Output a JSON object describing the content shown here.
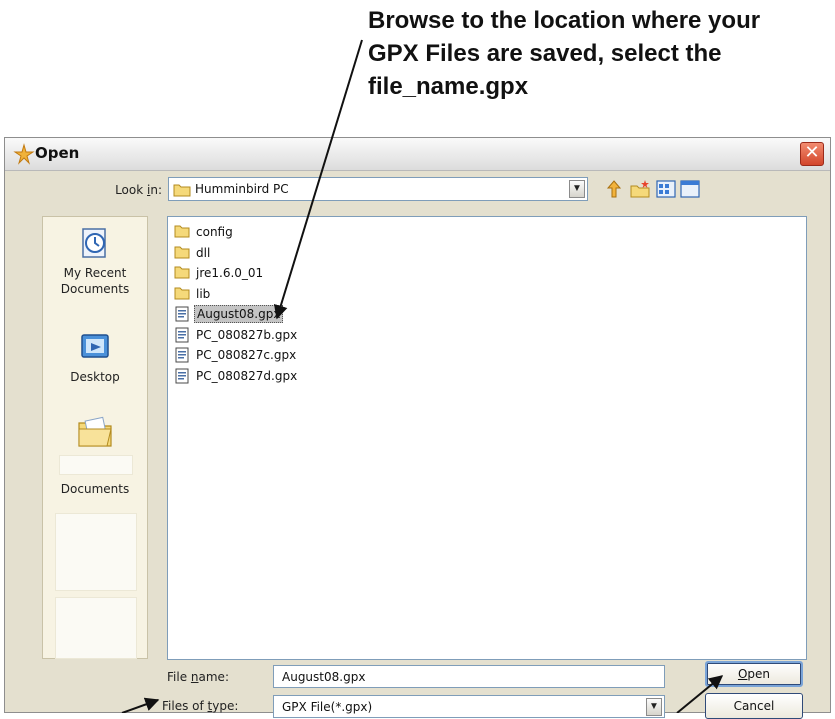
{
  "annotation": {
    "lines": [
      "Browse to the location where your",
      "GPX Files are saved, select the",
      "file_name.gpx"
    ]
  },
  "dialog": {
    "title": "Open",
    "close_symbol": "✕",
    "look_in": {
      "label_before": "Look ",
      "label_underlined": "i",
      "label_after": "n:",
      "value": "Humminbird PC"
    },
    "toolbar_icons": [
      "up-folder-icon",
      "new-folder-icon",
      "view-menu-icon",
      "details-view-icon"
    ],
    "places": [
      {
        "name": "my-recent-documents",
        "label_line1": "My Recent",
        "label_line2": "Documents",
        "icon": "recent-documents-icon"
      },
      {
        "name": "desktop",
        "label_line1": "Desktop",
        "label_line2": "",
        "icon": "desktop-icon"
      },
      {
        "name": "documents",
        "label_line1": "Documents",
        "label_line2": "",
        "icon": "documents-folder-icon"
      }
    ],
    "files": [
      {
        "name": "config",
        "type": "folder",
        "selected": false
      },
      {
        "name": "dll",
        "type": "folder",
        "selected": false
      },
      {
        "name": "jre1.6.0_01",
        "type": "folder",
        "selected": false
      },
      {
        "name": "lib",
        "type": "folder",
        "selected": false
      },
      {
        "name": "August08.gpx",
        "type": "file",
        "selected": true
      },
      {
        "name": "PC_080827b.gpx",
        "type": "file",
        "selected": false
      },
      {
        "name": "PC_080827c.gpx",
        "type": "file",
        "selected": false
      },
      {
        "name": "PC_080827d.gpx",
        "type": "file",
        "selected": false
      }
    ],
    "file_name": {
      "label_before": "File ",
      "label_underlined": "n",
      "label_after": "ame:",
      "value": "August08.gpx"
    },
    "file_type": {
      "label_before": "Files of ",
      "label_underlined": "t",
      "label_after": "ype:",
      "value": "GPX File(*.gpx)"
    },
    "open_button": {
      "underlined": "O",
      "rest": "pen"
    },
    "cancel_button": "Cancel"
  }
}
